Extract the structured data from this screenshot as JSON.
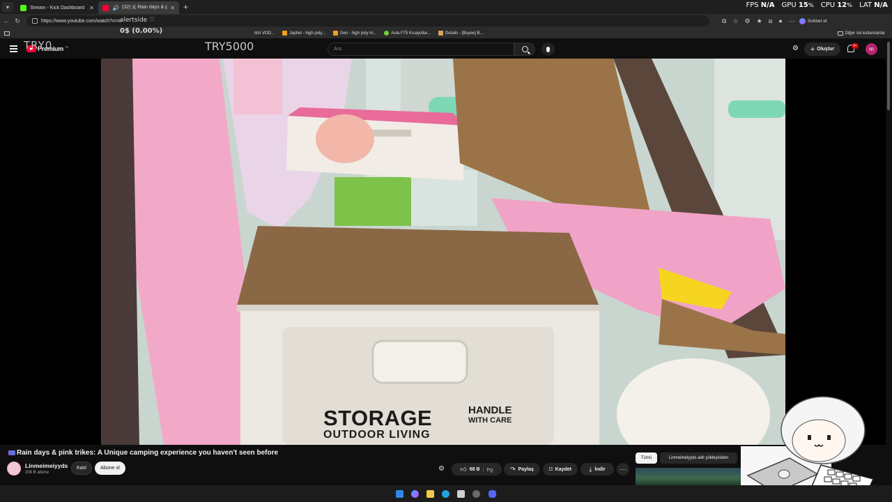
{
  "browser": {
    "tabs": [
      {
        "label": "Stream - Kick Dashboard"
      },
      {
        "label": "(32) 🇰 Rain days & pink trike"
      }
    ],
    "url": "https://www.youtube.com/watch?v=m",
    "bookmarks": [
      "itch VOD...",
      "Japhet - high poly...",
      "Gen - high poly m...",
      "Aula F75 Kısayollar...",
      "Details - [Buyee] B..."
    ],
    "bookmarks_other": "Diğer sık kullanılanlar",
    "chat_label": "Sohbet et"
  },
  "overlay": {
    "fps_label": "FPS",
    "fps_value": "N/A",
    "gpu_label": "GPU",
    "gpu_value": "15",
    "cpu_label": "CPU",
    "cpu_value": "12",
    "lat_label": "LAT",
    "lat_value": "N/A",
    "percent_unit": "%",
    "counter": "0$ (0.00%)",
    "alert_text": "alertside ♡",
    "logo_text": "TRY0",
    "code_text": "TRY5000"
  },
  "youtube": {
    "logo": "Premium",
    "logo_region": "TR",
    "search_placeholder": "Ara",
    "create_label": "Oluştur",
    "notif_badge": "9+",
    "avatar_letter": "m"
  },
  "video": {
    "storage_text": "STORAGE",
    "outdoor_text": "OUTDOOR LIVING",
    "handle_text": "HANDLE",
    "care_text": "WITH CARE"
  },
  "info": {
    "title": "Rain days & pink trikes: A Unique camping experience you haven't seen before",
    "channel": "Linmeimeiyyds",
    "subscribers": "208 B abone",
    "join_label": "Katıl",
    "subscribe_label": "Abone ol",
    "like_count": "68 B",
    "share_label": "Paylaş",
    "save_label": "Kaydet",
    "download_label": "İndir",
    "chip_all": "Tümü",
    "chip_uploader": "Linmeimeiyyds adlı yükleyiciden"
  },
  "colors": {
    "yt_red": "#ff0033",
    "pink": "#f2a9c8",
    "box_white": "#ece9e2",
    "wood": "#8a6846"
  }
}
